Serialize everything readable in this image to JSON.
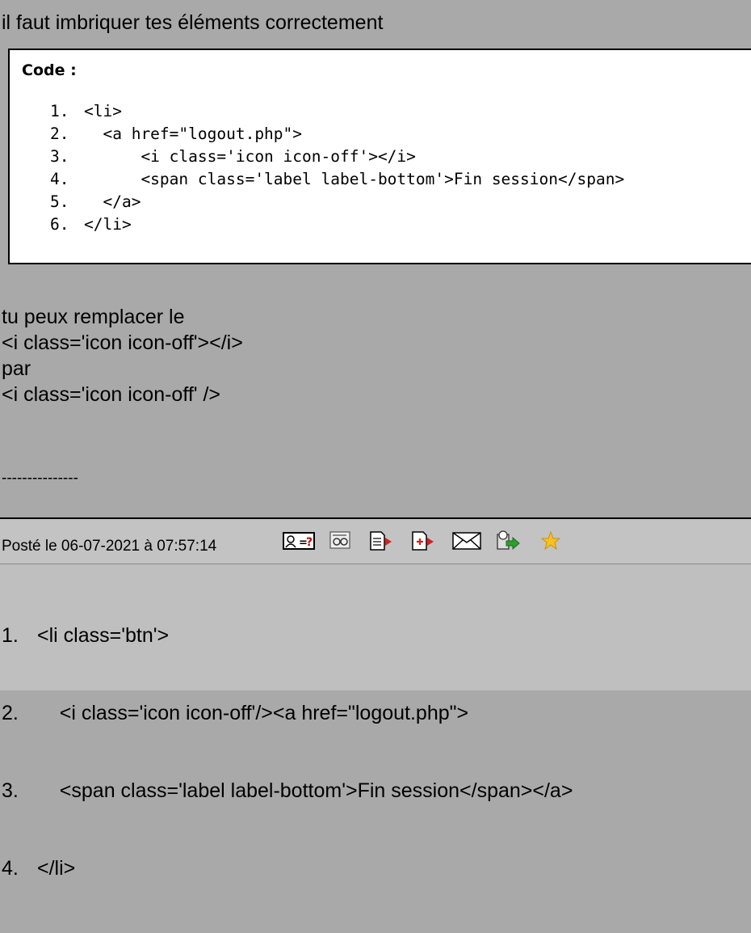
{
  "post1": {
    "intro": "il faut imbriquer tes éléments correctement",
    "code_title": "Code :",
    "code_lines": [
      {
        "num": "1.",
        "text": "<li>"
      },
      {
        "num": "2.",
        "text": "  <a href=\"logout.php\">"
      },
      {
        "num": "3.",
        "text": "      <i class='icon icon-off'></i>"
      },
      {
        "num": "4.",
        "text": "      <span class='label label-bottom'>Fin session</span>"
      },
      {
        "num": "5.",
        "text": "  </a>"
      },
      {
        "num": "6.",
        "text": "</li>"
      }
    ],
    "body_lines": [
      "tu peux remplacer le",
      "<i class='icon icon-off'></i>",
      "par",
      "<i class='icon icon-off' />"
    ],
    "signature": "---------------"
  },
  "post_bar": {
    "posted_text": "Posté le 06-07-2021 à 07:57:14",
    "icons": [
      "profile-icon",
      "quote-icon",
      "edit-icon",
      "add-quote-icon",
      "message-icon",
      "alert-icon",
      "favorite-star-icon"
    ]
  },
  "post2": {
    "lines": [
      {
        "num": "1.",
        "text": "<li class='btn'>"
      },
      {
        "num": "2.",
        "text": "    <i class='icon icon-off'/><a href=\"logout.php\">"
      },
      {
        "num": "3.",
        "text": "    <span class='label label-bottom'>Fin session</span></a>"
      },
      {
        "num": "4.",
        "text": "</li>"
      }
    ]
  }
}
